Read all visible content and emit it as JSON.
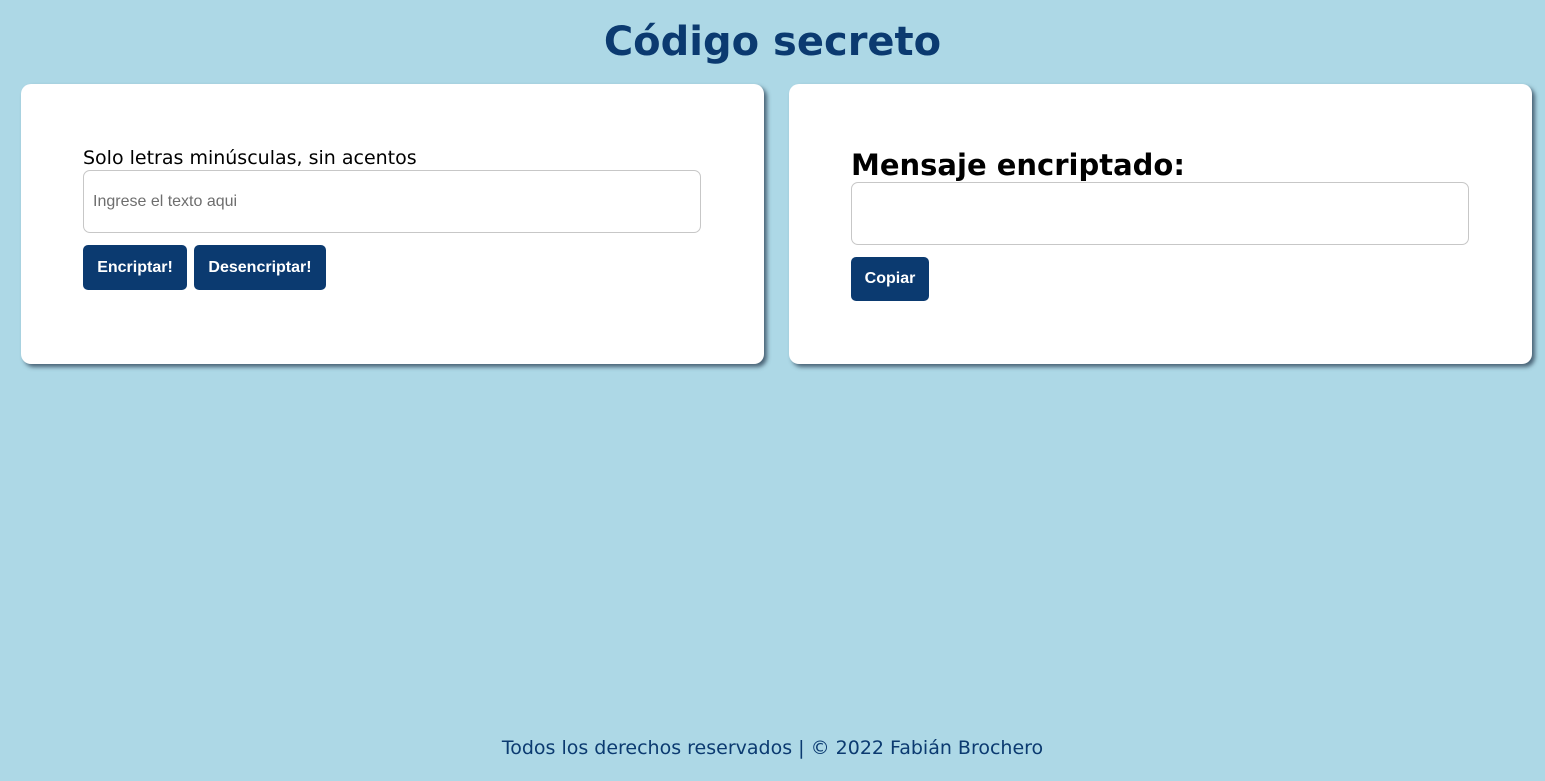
{
  "header": {
    "title": "Código secreto"
  },
  "encrypt_panel": {
    "instruction": "Solo letras minúsculas, sin acentos",
    "input": {
      "value": "",
      "placeholder": "Ingrese el texto aqui"
    },
    "encrypt_label": "Encriptar!",
    "decrypt_label": "Desencriptar!"
  },
  "result_panel": {
    "heading": "Mensaje encriptado:",
    "output": {
      "value": ""
    },
    "copy_label": "Copiar"
  },
  "footer": {
    "text": "Todos los derechos reservados | © 2022 Fabián Brochero"
  },
  "colors": {
    "background": "#add8e6",
    "accent": "#0b3a70",
    "card": "#ffffff"
  }
}
